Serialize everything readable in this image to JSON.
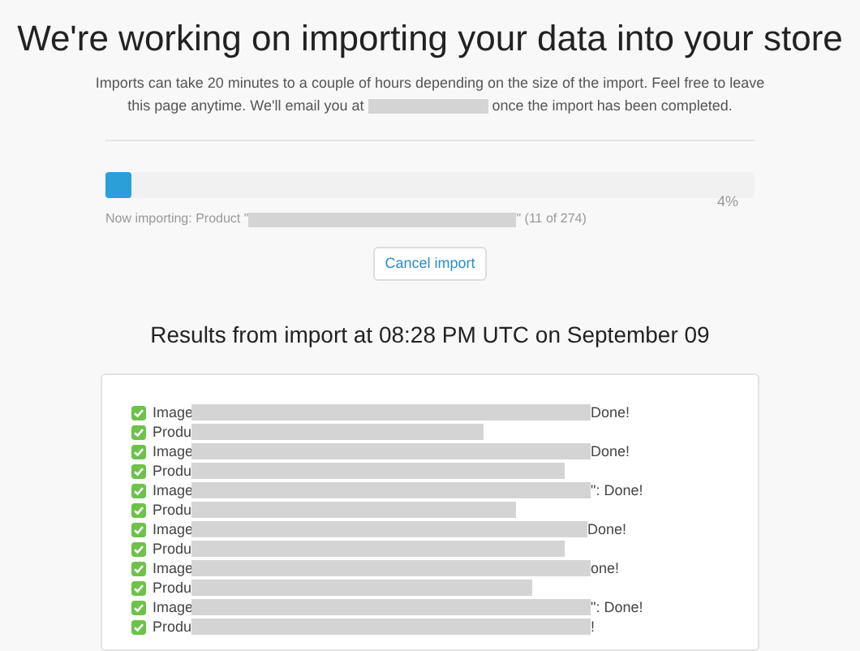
{
  "title": "We're working on importing your data into your store",
  "intro": {
    "before": "Imports can take 20 minutes to a couple of hours depending on the size of the import. Feel free to leave this page anytime. We'll email you at",
    "after": "once the import has been completed."
  },
  "progress": {
    "level": 0.04,
    "percent": "4%",
    "status_before": "Now importing: Product \"",
    "status_after": "\" (11 of 274)"
  },
  "cancel_button": "Cancel import",
  "results_heading": "Results from import at 08:28 PM UTC on September 09",
  "log": [
    {
      "prefix": "Image",
      "suffix": "Done!",
      "checked": true
    },
    {
      "prefix": "Produ",
      "checked": true
    },
    {
      "prefix": "Image",
      "suffix": "Done!",
      "checked": true
    },
    {
      "prefix": "Produ",
      "checked": true
    },
    {
      "prefix": "Image",
      "suffix": "\": Done!",
      "checked": true
    },
    {
      "prefix": "Produ",
      "checked": true
    },
    {
      "prefix": "Image",
      "suffix": "Done!",
      "checked": true
    },
    {
      "prefix": "Produ",
      "checked": true
    },
    {
      "prefix": "Image",
      "suffix": "one!",
      "checked": true
    },
    {
      "prefix": "Produ",
      "checked": true
    },
    {
      "prefix": "Image",
      "suffix": "\": Done!",
      "checked": true
    },
    {
      "prefix": "Produ",
      "suffix": "!",
      "checked": true
    }
  ]
}
